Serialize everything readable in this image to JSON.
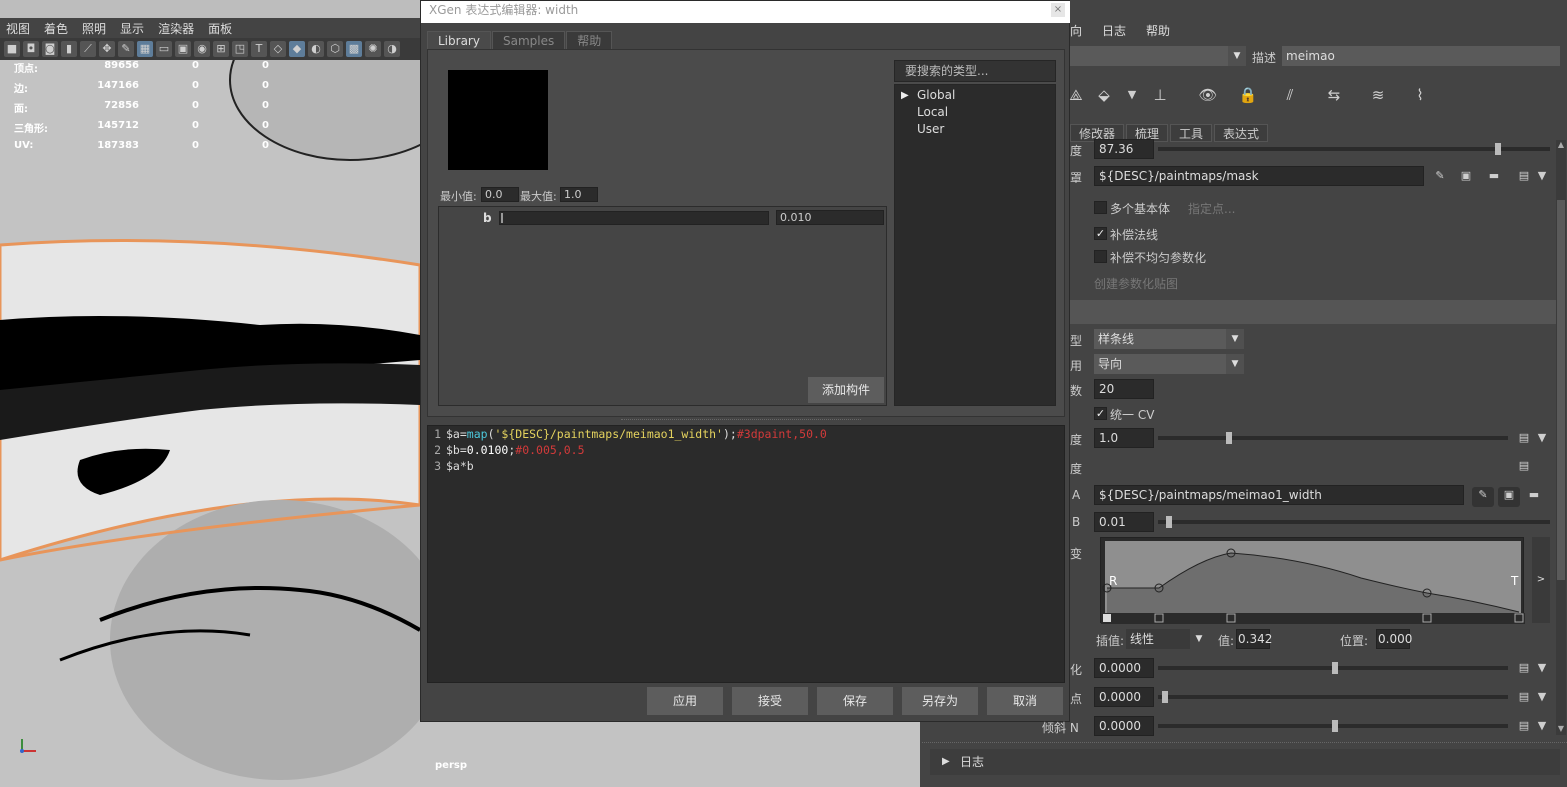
{
  "viewport": {
    "menu": [
      "视图",
      "着色",
      "照明",
      "显示",
      "渲染器",
      "面板"
    ],
    "stats": [
      {
        "label": "顶点:",
        "v1": "89656",
        "v2": "0",
        "v3": "0"
      },
      {
        "label": "边:",
        "v1": "147166",
        "v2": "0",
        "v3": "0"
      },
      {
        "label": "面:",
        "v1": "72856",
        "v2": "0",
        "v3": "0"
      },
      {
        "label": "三角形:",
        "v1": "145712",
        "v2": "0",
        "v3": "0"
      },
      {
        "label": "UV:",
        "v1": "187383",
        "v2": "0",
        "v3": "0"
      }
    ],
    "camera": "persp"
  },
  "editor": {
    "title": "XGen 表达式编辑器: width",
    "close": "×",
    "tabs": [
      "Library",
      "Samples",
      "帮助"
    ],
    "min_label": "最小值:",
    "min_value": "0.0",
    "max_label": "最大值:",
    "max_value": "1.0",
    "param_b_label": "b",
    "param_b_value": "0.010",
    "add_component": "添加构件",
    "search_placeholder": "要搜索的类型...",
    "tree": [
      "Global",
      "Local",
      "User"
    ],
    "code": [
      {
        "n": "1",
        "parts": [
          [
            "var",
            "$a="
          ],
          [
            "fn",
            "map"
          ],
          [
            "var",
            "("
          ],
          [
            "str",
            "'${DESC}/paintmaps/meimao1_width'"
          ],
          [
            "var",
            ");"
          ],
          [
            "cm",
            "#3dpaint,50.0"
          ]
        ]
      },
      {
        "n": "2",
        "parts": [
          [
            "var",
            "$b="
          ],
          [
            "num",
            "0.0100"
          ],
          [
            "var",
            ";"
          ],
          [
            "cm",
            "#0.005,0.5"
          ]
        ]
      },
      {
        "n": "3",
        "parts": [
          [
            "var",
            "$a*b"
          ]
        ]
      }
    ],
    "buttons": [
      "应用",
      "接受",
      "保存",
      "另存为",
      "取消"
    ]
  },
  "attr": {
    "menu": [
      "向",
      "日志",
      "帮助"
    ],
    "desc_label": "描述",
    "desc_value": "meimao",
    "tabs": [
      "修改器",
      "梳理",
      "工具",
      "表达式"
    ],
    "density_label": "度",
    "density_value": "87.36",
    "mask_label": "罩",
    "mask_value": "${DESC}/paintmaps/mask",
    "multi_base": "多个基本体",
    "specify_points": "指定点...",
    "comp_normal": "补偿法线",
    "comp_param": "补偿不均匀参数化",
    "create_param_map": "创建参数化贴图",
    "type_label": "型",
    "type_value": "样条线",
    "use_label": "用",
    "use_value": "导向",
    "count_label": "数",
    "count_value": "20",
    "uniform_cv": "统一 CV",
    "width_label": "度",
    "width_value": "1.0",
    "taper_label": "度",
    "a_label": "A",
    "a_value": "${DESC}/paintmaps/meimao1_width",
    "b_label": "B",
    "b_value": "0.01",
    "ramp_label": "变",
    "ramp_r": "R",
    "ramp_t": "T",
    "interp_label": "插值:",
    "interp_value": "线性",
    "value_label": "值:",
    "value_value": "0.342",
    "pos_label": "位置:",
    "pos_value": "0.000",
    "f1_label": "化",
    "f1_value": "0.0000",
    "f2_label": "点",
    "f2_value": "0.0000",
    "f3_label": "倾斜 N",
    "f3_value": "0.0000",
    "log": "日志"
  }
}
